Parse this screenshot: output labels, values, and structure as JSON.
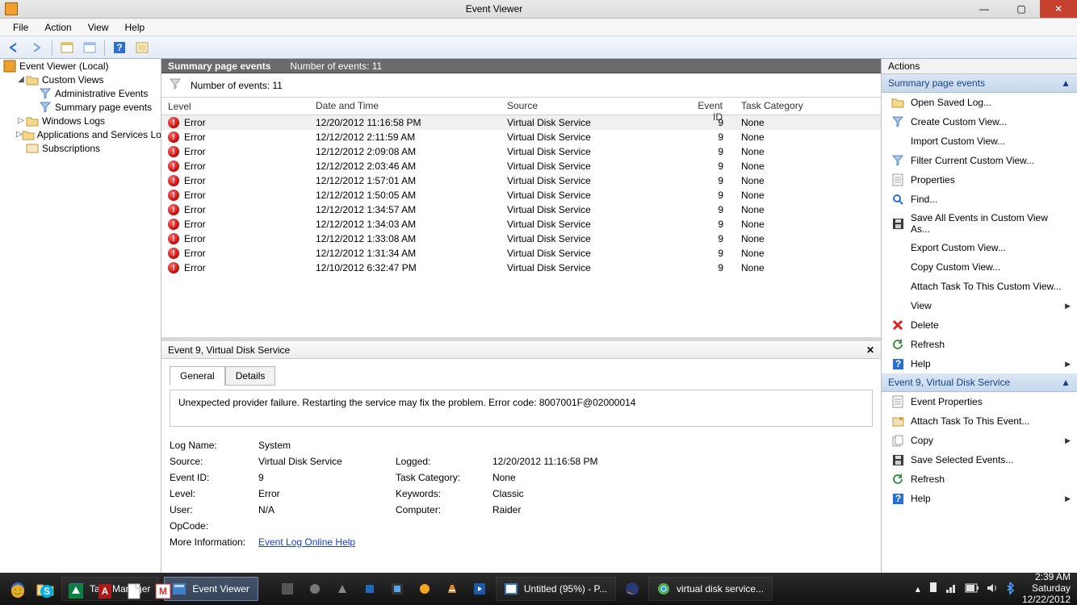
{
  "window": {
    "title": "Event Viewer",
    "menus": [
      "File",
      "Action",
      "View",
      "Help"
    ]
  },
  "tree": {
    "root": "Event Viewer (Local)",
    "items": [
      {
        "label": "Custom Views",
        "expanded": true,
        "children": [
          {
            "label": "Administrative Events"
          },
          {
            "label": "Summary page events"
          }
        ]
      },
      {
        "label": "Windows Logs"
      },
      {
        "label": "Applications and Services Lo"
      },
      {
        "label": "Subscriptions"
      }
    ]
  },
  "summary": {
    "title": "Summary page events",
    "count_label": "Number of events: 11",
    "filter_count_label": "Number of events: 11"
  },
  "columns": {
    "level": "Level",
    "date": "Date and Time",
    "source": "Source",
    "eventid": "Event ID",
    "task": "Task Category"
  },
  "events": [
    {
      "level": "Error",
      "date": "12/20/2012 11:16:58 PM",
      "source": "Virtual Disk Service",
      "id": "9",
      "task": "None",
      "selected": true
    },
    {
      "level": "Error",
      "date": "12/12/2012 2:11:59 AM",
      "source": "Virtual Disk Service",
      "id": "9",
      "task": "None"
    },
    {
      "level": "Error",
      "date": "12/12/2012 2:09:08 AM",
      "source": "Virtual Disk Service",
      "id": "9",
      "task": "None"
    },
    {
      "level": "Error",
      "date": "12/12/2012 2:03:46 AM",
      "source": "Virtual Disk Service",
      "id": "9",
      "task": "None"
    },
    {
      "level": "Error",
      "date": "12/12/2012 1:57:01 AM",
      "source": "Virtual Disk Service",
      "id": "9",
      "task": "None"
    },
    {
      "level": "Error",
      "date": "12/12/2012 1:50:05 AM",
      "source": "Virtual Disk Service",
      "id": "9",
      "task": "None"
    },
    {
      "level": "Error",
      "date": "12/12/2012 1:34:57 AM",
      "source": "Virtual Disk Service",
      "id": "9",
      "task": "None"
    },
    {
      "level": "Error",
      "date": "12/12/2012 1:34:03 AM",
      "source": "Virtual Disk Service",
      "id": "9",
      "task": "None"
    },
    {
      "level": "Error",
      "date": "12/12/2012 1:33:08 AM",
      "source": "Virtual Disk Service",
      "id": "9",
      "task": "None"
    },
    {
      "level": "Error",
      "date": "12/12/2012 1:31:34 AM",
      "source": "Virtual Disk Service",
      "id": "9",
      "task": "None"
    },
    {
      "level": "Error",
      "date": "12/10/2012 6:32:47 PM",
      "source": "Virtual Disk Service",
      "id": "9",
      "task": "None"
    }
  ],
  "details": {
    "title": "Event 9, Virtual Disk Service",
    "tabs": {
      "general": "General",
      "details": "Details"
    },
    "message": "Unexpected provider failure. Restarting the service may fix the problem. Error code: 8007001F@02000014",
    "fields": {
      "log_name_label": "Log Name:",
      "log_name": "System",
      "source_label": "Source:",
      "source": "Virtual Disk Service",
      "logged_label": "Logged:",
      "logged": "12/20/2012 11:16:58 PM",
      "eventid_label": "Event ID:",
      "eventid": "9",
      "taskcat_label": "Task Category:",
      "taskcat": "None",
      "level_label": "Level:",
      "level": "Error",
      "keywords_label": "Keywords:",
      "keywords": "Classic",
      "user_label": "User:",
      "user": "N/A",
      "computer_label": "Computer:",
      "computer": "Raider",
      "opcode_label": "OpCode:",
      "moreinfo_label": "More Information:",
      "moreinfo_link": "Event Log Online Help"
    }
  },
  "actions": {
    "header": "Actions",
    "section1": "Summary page events",
    "items1": [
      {
        "icon": "folder-open",
        "label": "Open Saved Log..."
      },
      {
        "icon": "funnel",
        "label": "Create Custom View..."
      },
      {
        "icon": "",
        "label": "Import Custom View..."
      },
      {
        "icon": "funnel",
        "label": "Filter Current Custom View..."
      },
      {
        "icon": "props",
        "label": "Properties"
      },
      {
        "icon": "find",
        "label": "Find..."
      },
      {
        "icon": "save",
        "label": "Save All Events in Custom View As..."
      },
      {
        "icon": "",
        "label": "Export Custom View..."
      },
      {
        "icon": "",
        "label": "Copy Custom View..."
      },
      {
        "icon": "",
        "label": "Attach Task To This Custom View..."
      },
      {
        "icon": "",
        "label": "View",
        "sub": true
      },
      {
        "icon": "delete",
        "label": "Delete"
      },
      {
        "icon": "refresh",
        "label": "Refresh"
      },
      {
        "icon": "help",
        "label": "Help",
        "sub": true
      }
    ],
    "section2": "Event 9, Virtual Disk Service",
    "items2": [
      {
        "icon": "props",
        "label": "Event Properties"
      },
      {
        "icon": "attach",
        "label": "Attach Task To This Event..."
      },
      {
        "icon": "copy",
        "label": "Copy",
        "sub": true
      },
      {
        "icon": "save",
        "label": "Save Selected Events..."
      },
      {
        "icon": "refresh",
        "label": "Refresh"
      },
      {
        "icon": "help",
        "label": "Help",
        "sub": true
      }
    ]
  },
  "taskbar": {
    "buttons": [
      {
        "icon": "taskmgr",
        "label": "Task Manager"
      },
      {
        "icon": "eventvwr",
        "label": "Event Viewer",
        "active": true
      }
    ],
    "mid_buttons": [
      {
        "icon": "paint",
        "label": "Untitled (95%) - P..."
      },
      {
        "icon": "chrome",
        "label": "virtual disk service..."
      }
    ],
    "clock": {
      "time": "2:39 AM",
      "day": "Saturday",
      "date": "12/22/2012"
    }
  }
}
